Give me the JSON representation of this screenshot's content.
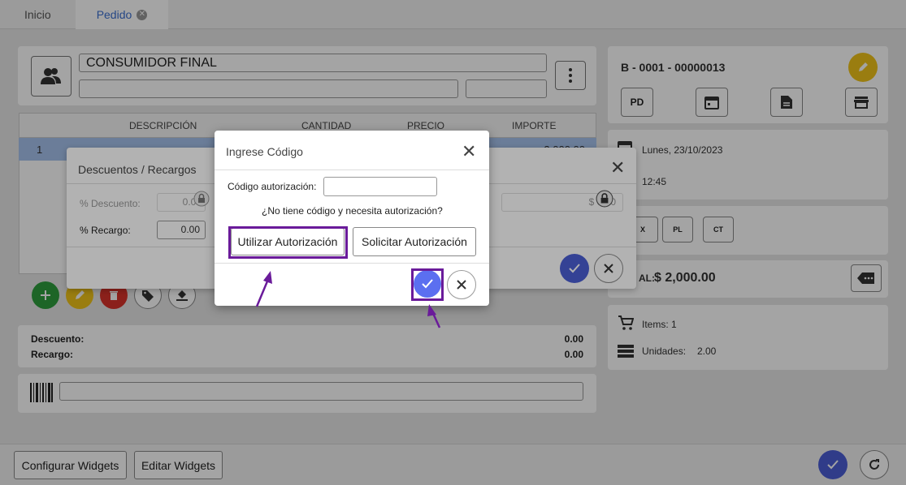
{
  "tabs": [
    {
      "label": "Inicio"
    },
    {
      "label": "Pedido"
    }
  ],
  "customer": {
    "name": "CONSUMIDOR FINAL"
  },
  "table": {
    "headers": [
      "DESCRIPCIÓN",
      "CANTIDAD",
      "PRECIO",
      "IMPORTE"
    ],
    "rows": [
      {
        "num": "1",
        "importe": "2,000.00"
      }
    ]
  },
  "totals": {
    "descuento_label": "Descuento:",
    "descuento_value": "0.00",
    "recargo_label": "Recargo:",
    "recargo_value": "0.00"
  },
  "right_panel": {
    "doc_number": "B - 0001 - 00000013",
    "pd_label": "PD",
    "date": "Lunes, 23/10/2023",
    "time": "12:45",
    "pl_label": "PL",
    "ct_label": "CT",
    "total_label": "AL:",
    "total_value": "$ 2,000.00",
    "items_label": "Items: 1",
    "units_label": "Unidades:",
    "units_value": "2.00"
  },
  "bottom": {
    "configure_label": "Configurar Widgets",
    "edit_label": "Editar Widgets"
  },
  "discount_dialog": {
    "title": "Descuentos / Recargos",
    "descuento_label": "% Descuento:",
    "descuento_value": "0.00",
    "recargo_label": "% Recargo:",
    "recargo_value": "0.00",
    "amount_value": "$ 0.00"
  },
  "code_dialog": {
    "title": "Ingrese Código",
    "code_label": "Código autorización:",
    "code_value": "",
    "question": "¿No tiene código y necesita autorización?",
    "use_auth_label": "Utilizar Autorización",
    "request_auth_label": "Solicitar Autorización"
  },
  "colors": {
    "accent_blue": "#4b5fd6",
    "highlight_purple": "#6a1b9a",
    "tab_active": "#3b6fd1",
    "add_green": "#2e9e3e",
    "edit_yellow": "#f0c419",
    "delete_red": "#d9342b"
  }
}
